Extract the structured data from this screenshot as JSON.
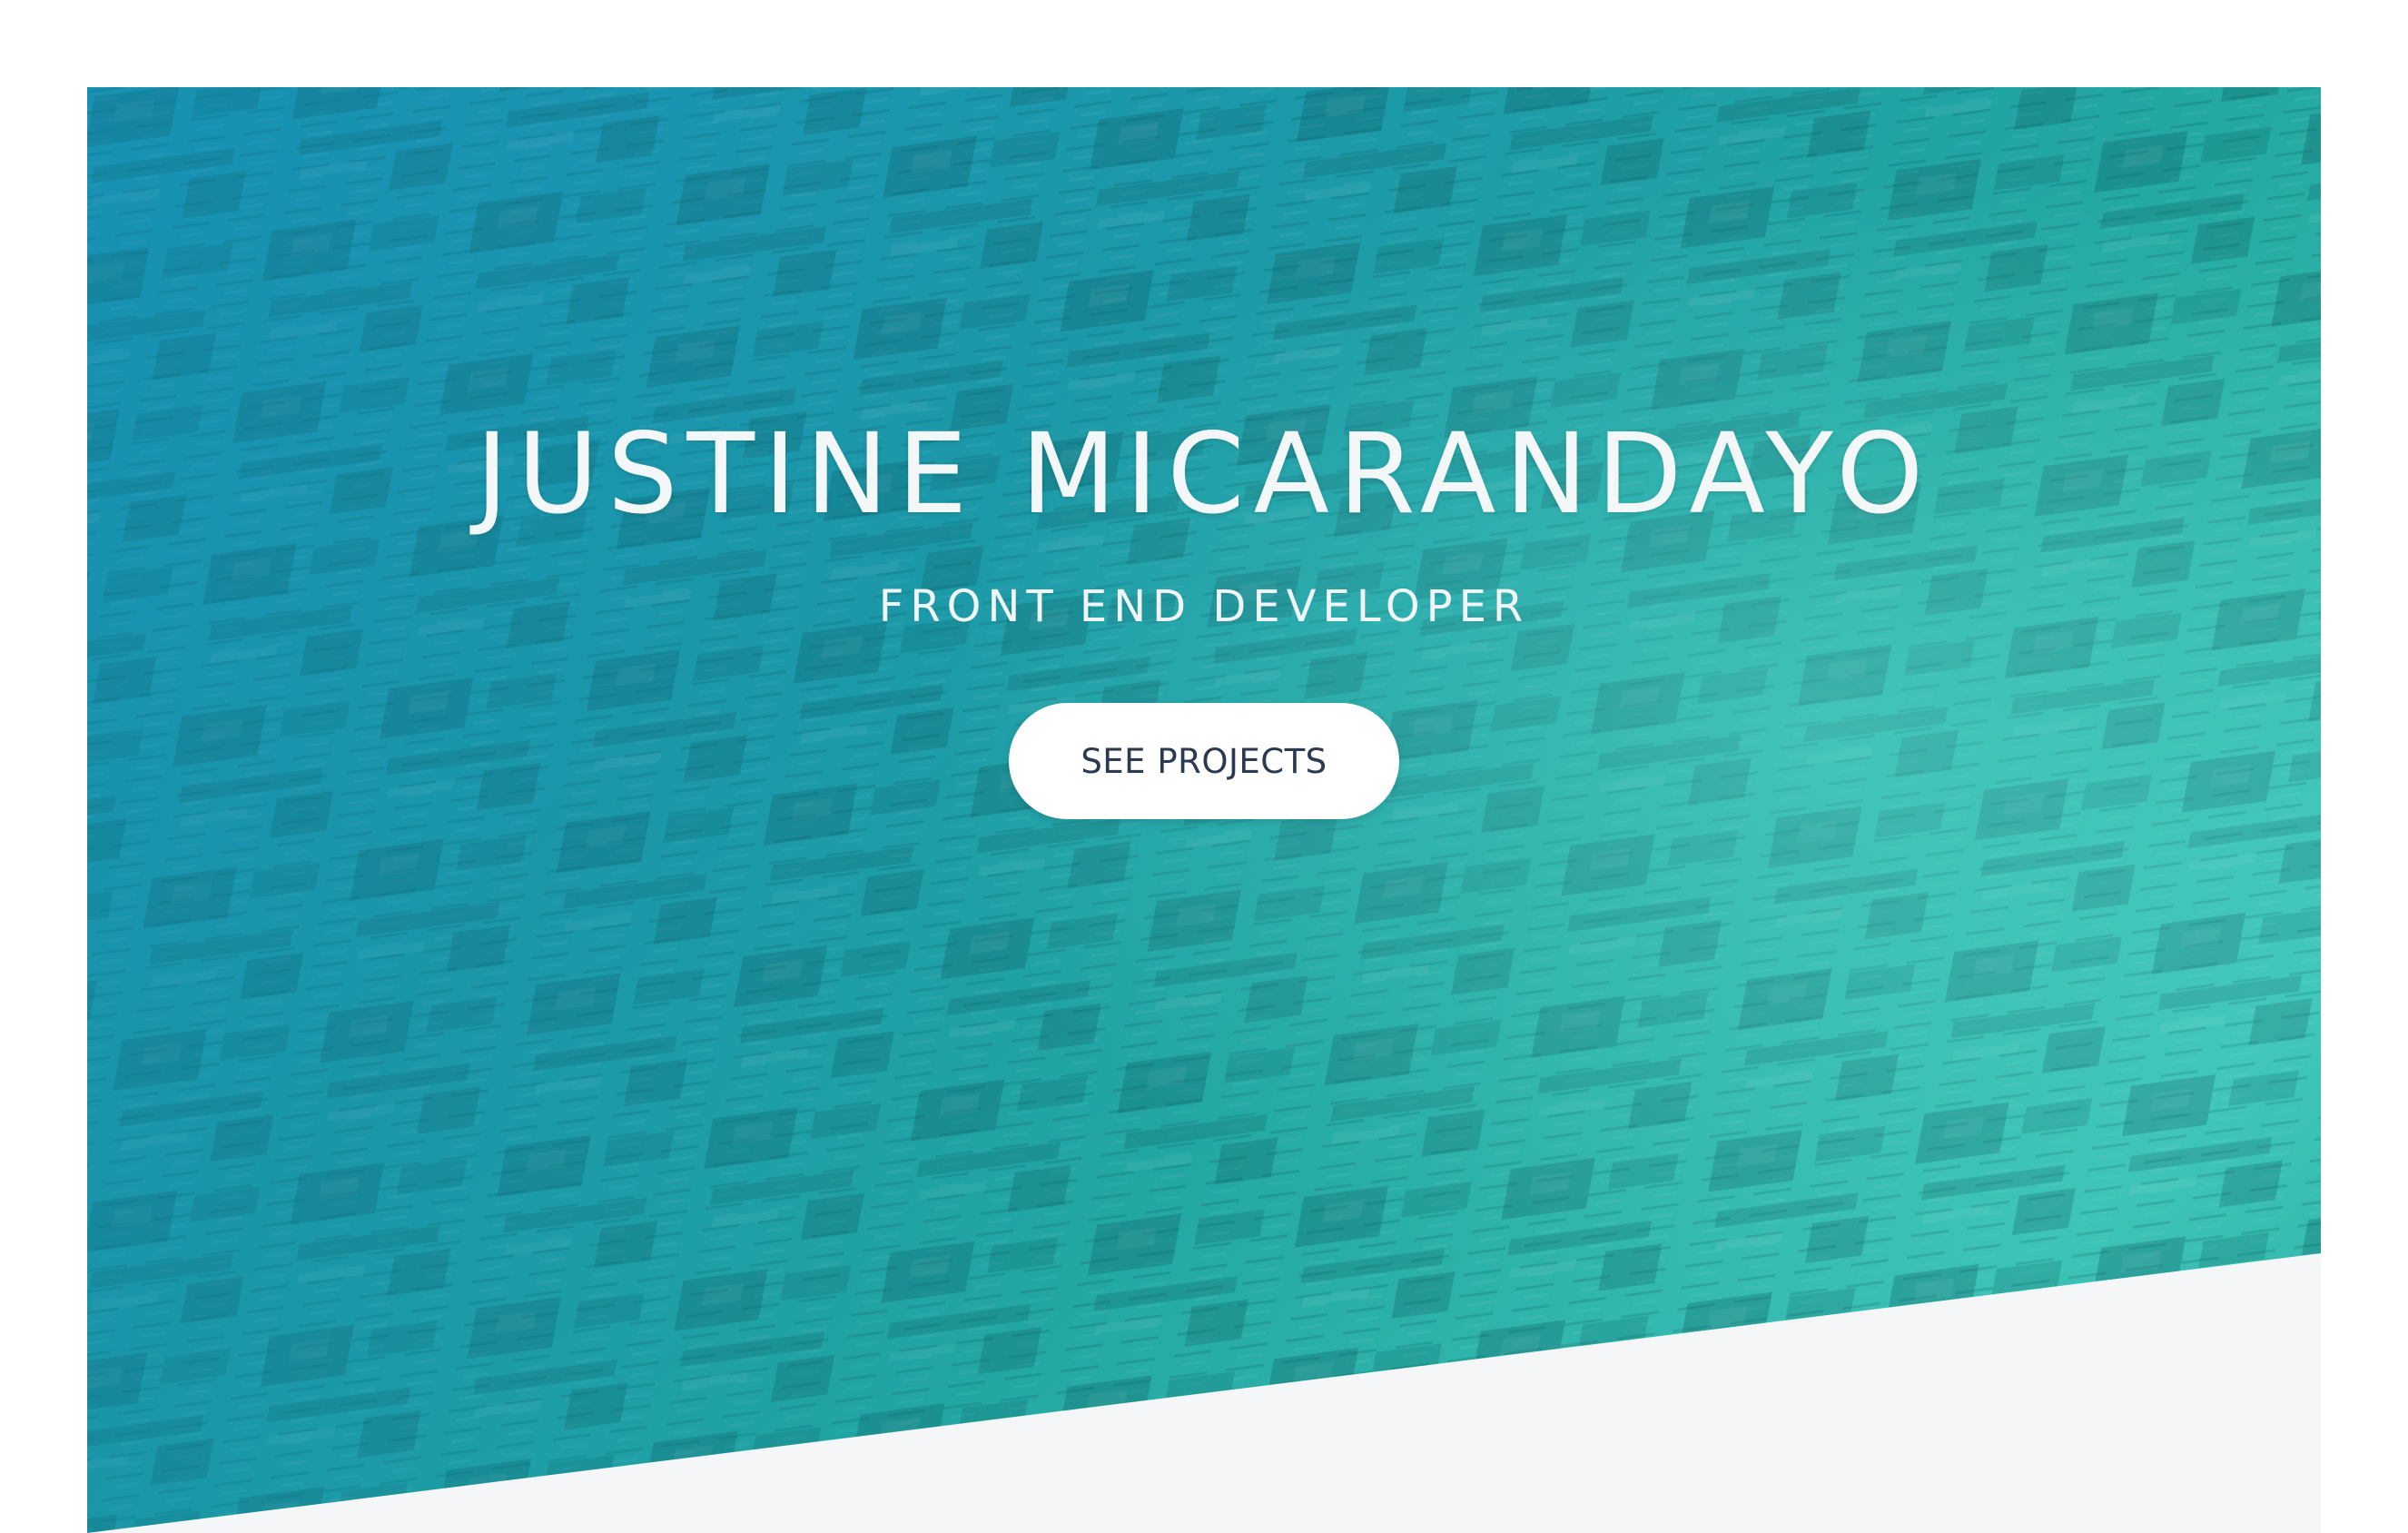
{
  "hero": {
    "title": "JUSTINE MICARANDAYO",
    "subtitle": "FRONT END DEVELOPER",
    "cta_label": "SEE PROJECTS",
    "background_image": "circuit-board-photo",
    "overlay_colors": [
      "#1a93b8",
      "#24a9a2",
      "#3cc3b6"
    ]
  },
  "colors": {
    "page_background": "#ffffff",
    "section_background": "#f5f6f7",
    "button_background": "#ffffff",
    "button_text": "#2b3a52",
    "hero_text": "#f4f7f8"
  }
}
